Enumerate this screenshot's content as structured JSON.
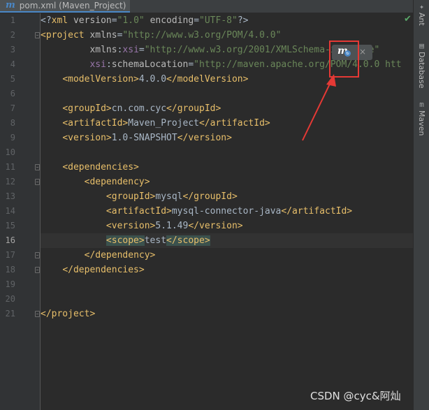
{
  "tab": {
    "icon": "m",
    "title": "pom.xml (Maven_Project)"
  },
  "gutter": {
    "line_numbers": [
      "1",
      "2",
      "3",
      "4",
      "5",
      "6",
      "7",
      "8",
      "9",
      "10",
      "11",
      "12",
      "13",
      "14",
      "15",
      "16",
      "17",
      "18",
      "19",
      "20",
      "21"
    ],
    "current_line": "16"
  },
  "code": {
    "l1": {
      "lt": "<?",
      "tag": "xml",
      "sp1": " ",
      "a1": "version",
      "eq1": "=",
      "v1": "\"1.0\"",
      "sp2": " ",
      "a2": "encoding",
      "eq2": "=",
      "v2": "\"UTF-8\"",
      "gt": "?>"
    },
    "l2": {
      "lt": "<",
      "tag": "project",
      "sp": " ",
      "a": "xmlns",
      "eq": "=",
      "v": "\"http://www.w3.org/POM/4.0.0\""
    },
    "l3": {
      "ind": "         ",
      "a": "xmlns",
      "colon": ":",
      "ns": "xsi",
      "eq": "=",
      "v": "\"http://www.w3.org/2001/XMLSchema-instance\""
    },
    "l4": {
      "ind": "         ",
      "ns": "xsi",
      "colon": ":",
      "a": "schemaLocation",
      "eq": "=",
      "v": "\"http://maven.apache.org/POM/4.0.0 htt"
    },
    "l5": {
      "ind": "    ",
      "open": "<modelVersion>",
      "text": "4.0.0",
      "close": "</modelVersion>"
    },
    "l7": {
      "ind": "    ",
      "open": "<groupId>",
      "text": "cn.com.cyc",
      "close": "</groupId>"
    },
    "l8": {
      "ind": "    ",
      "open": "<artifactId>",
      "text": "Maven_Project",
      "close": "</artifactId>"
    },
    "l9": {
      "ind": "    ",
      "open": "<version>",
      "text": "1.0-SNAPSHOT",
      "close": "</version>"
    },
    "l11": {
      "ind": "    ",
      "open": "<dependencies>"
    },
    "l12": {
      "ind": "        ",
      "open": "<dependency>"
    },
    "l13": {
      "ind": "            ",
      "open": "<groupId>",
      "text": "mysql",
      "close": "</groupId>"
    },
    "l14": {
      "ind": "            ",
      "open": "<artifactId>",
      "text": "mysql-connector-java",
      "close": "</artifactId>"
    },
    "l15": {
      "ind": "            ",
      "open": "<version>",
      "text": "5.1.49",
      "close": "</version>"
    },
    "l16": {
      "ind": "            ",
      "open": "<scope>",
      "text": "test",
      "close": "</scope>"
    },
    "l17": {
      "ind": "        ",
      "close": "</dependency>"
    },
    "l18": {
      "ind": "    ",
      "close": "</dependencies>"
    },
    "l21": {
      "close": "</project>"
    }
  },
  "popup": {
    "icon": "m",
    "refresh_icon": "↻",
    "close": "×"
  },
  "inspection_status": "✔",
  "sidebar": {
    "items": [
      {
        "icon": "ant-icon",
        "glyph": "✦",
        "label": "Ant"
      },
      {
        "icon": "database-icon",
        "glyph": "▤",
        "label": "Database"
      },
      {
        "icon": "maven-icon",
        "glyph": "m",
        "label": "Maven"
      }
    ]
  },
  "watermark": "CSDN @cyc&阿灿",
  "colors": {
    "tag": "#e8bf6a",
    "attribute": "#bababa",
    "value": "#6a8759",
    "namespace": "#9876aa",
    "annotation": "#e53935",
    "maven": "#4a88c7"
  }
}
